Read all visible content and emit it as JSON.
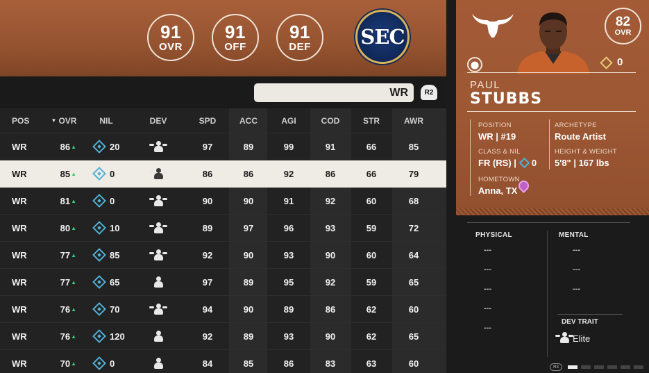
{
  "team_ratings": [
    {
      "value": "91",
      "label": "OVR"
    },
    {
      "value": "91",
      "label": "OFF"
    },
    {
      "value": "91",
      "label": "DEF"
    }
  ],
  "conference_logo": {
    "text": "SEC",
    "icon": "sec-logo"
  },
  "search": {
    "value": "WR",
    "button": "R2"
  },
  "table": {
    "columns": [
      "POS",
      "OVR",
      "NIL",
      "DEV",
      "SPD",
      "ACC",
      "AGI",
      "COD",
      "STR",
      "AWR"
    ],
    "sorted_column": "OVR",
    "rows": [
      {
        "pos": "WR",
        "ovr": "86",
        "nil": "20",
        "dev": "impact",
        "spd": "97",
        "acc": "89",
        "agi": "99",
        "cod": "91",
        "str": "66",
        "awr": "85"
      },
      {
        "pos": "WR",
        "ovr": "85",
        "nil": "0",
        "dev": "elite",
        "spd": "86",
        "acc": "86",
        "agi": "92",
        "cod": "86",
        "str": "66",
        "awr": "79"
      },
      {
        "pos": "WR",
        "ovr": "81",
        "nil": "0",
        "dev": "impact",
        "spd": "90",
        "acc": "90",
        "agi": "91",
        "cod": "92",
        "str": "60",
        "awr": "68"
      },
      {
        "pos": "WR",
        "ovr": "80",
        "nil": "10",
        "dev": "impact",
        "spd": "89",
        "acc": "97",
        "agi": "96",
        "cod": "93",
        "str": "59",
        "awr": "72"
      },
      {
        "pos": "WR",
        "ovr": "77",
        "nil": "85",
        "dev": "impact",
        "spd": "92",
        "acc": "90",
        "agi": "93",
        "cod": "90",
        "str": "60",
        "awr": "64"
      },
      {
        "pos": "WR",
        "ovr": "77",
        "nil": "65",
        "dev": "normal",
        "spd": "97",
        "acc": "89",
        "agi": "95",
        "cod": "92",
        "str": "59",
        "awr": "65"
      },
      {
        "pos": "WR",
        "ovr": "76",
        "nil": "70",
        "dev": "impact",
        "spd": "94",
        "acc": "90",
        "agi": "89",
        "cod": "86",
        "str": "62",
        "awr": "60"
      },
      {
        "pos": "WR",
        "ovr": "76",
        "nil": "120",
        "dev": "normal",
        "spd": "92",
        "acc": "89",
        "agi": "93",
        "cod": "90",
        "str": "62",
        "awr": "65"
      },
      {
        "pos": "WR",
        "ovr": "70",
        "nil": "0",
        "dev": "normal",
        "spd": "84",
        "acc": "85",
        "agi": "86",
        "cod": "83",
        "str": "63",
        "awr": "60"
      }
    ],
    "selected_row": 1
  },
  "player_card": {
    "ovr": "82",
    "ovr_label": "OVR",
    "first_name": "PAUL",
    "last_name": "STUBBS",
    "gem_count": "0",
    "position_label": "POSITION",
    "position_value": "WR | #19",
    "archetype_label": "ARCHETYPE",
    "archetype_value": "Route Artist",
    "class_label": "CLASS & NIL",
    "class_value": "FR (RS) |",
    "class_nil": "0",
    "hw_label": "HEIGHT & WEIGHT",
    "hw_value": "5'8\" | 167 lbs",
    "hometown_label": "HOMETOWN",
    "hometown_value": "Anna, TX"
  },
  "stats_panel": {
    "physical_label": "PHYSICAL",
    "mental_label": "MENTAL",
    "placeholder": "---",
    "dev_trait_label": "DEV TRAIT",
    "dev_trait_value": "Elite",
    "pager_button": "R3"
  },
  "colors": {
    "burnt_orange": "#9c5733",
    "selected_row": "#efece5",
    "nil_blue": "#4fb3d9",
    "up_green": "#2fd07a"
  }
}
